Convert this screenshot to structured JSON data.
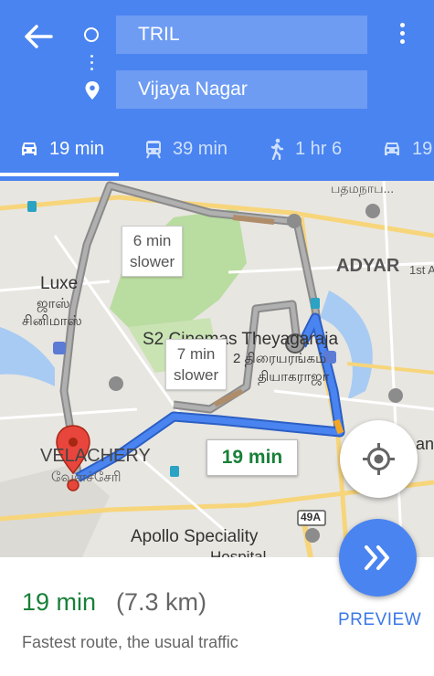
{
  "header": {
    "origin": "TRIL",
    "destination": "Vijaya Nagar"
  },
  "modes": [
    {
      "icon": "car-icon",
      "label": "19 min",
      "active": true
    },
    {
      "icon": "transit-icon",
      "label": "39 min",
      "active": false
    },
    {
      "icon": "walk-icon",
      "label": "1 hr 6",
      "active": false
    },
    {
      "icon": "cab-icon",
      "label": "19",
      "active": false
    }
  ],
  "map": {
    "labels": {
      "luxe": "Luxe",
      "luxe_tamil": "ஜாஸ்",
      "luxe_cinemas_tamil": "சினிமாஸ்",
      "adyar": "ADYAR",
      "first_ave": "1st A",
      "s2_cinemas": "S2 Cinemas Theyagaraja",
      "s2_tamil": "2 திரையரங்கம்",
      "theyagaraja_tamil": "தியாகராஜா",
      "velachery": "VELACHERY",
      "velachery_tamil": "வேளச்சேரி",
      "apollo": "Apollo Speciality",
      "hospital": "Hospital",
      "top_tamil": "பதமநாப...",
      "road_49a": "49A",
      "edge_an": "an"
    },
    "alt_routes": [
      {
        "text_line1": "6 min",
        "text_line2": "slower"
      },
      {
        "text_line1": "7 min",
        "text_line2": "slower"
      }
    ],
    "route_eta": "19 min"
  },
  "summary": {
    "time": "19 min",
    "distance": "(7.3 km)",
    "description": "Fastest route, the usual traffic",
    "preview_label": "PREVIEW"
  },
  "colors": {
    "header_blue": "#4a84f0",
    "route_blue": "#4a84f0",
    "alt_route_gray": "#9e9e9e",
    "eta_green": "#188038"
  }
}
